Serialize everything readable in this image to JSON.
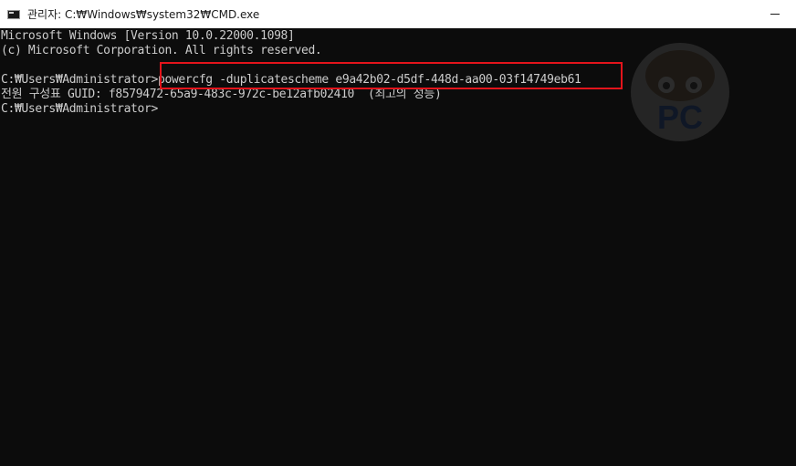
{
  "window": {
    "title": "관리자: C:₩Windows₩system32₩CMD.exe"
  },
  "console": {
    "lines": [
      "Microsoft Windows [Version 10.0.22000.1098]",
      "(c) Microsoft Corporation. All rights reserved.",
      "",
      "C:₩Users₩Administrator>",
      "전원 구성표 GUID: f8579472-65a9-483c-972c-be12afb02410  (최고의 성능)",
      "C:₩Users₩Administrator>"
    ],
    "prompt": "C:₩Users₩Administrator>",
    "command": "powercfg -duplicatescheme e9a42b02-d5df-448d-aa00-03f14749eb61"
  },
  "watermark": {
    "text": "PC"
  },
  "colors": {
    "background": "#0c0c0c",
    "text": "#cccccc",
    "highlight_border": "#e3141b",
    "titlebar": "#ffffff"
  }
}
